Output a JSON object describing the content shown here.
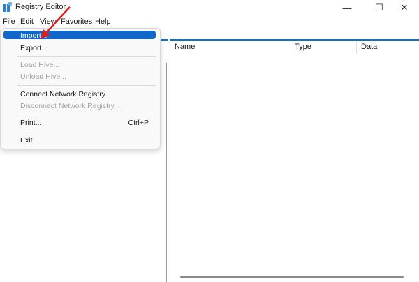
{
  "window": {
    "title": "Registry Editor",
    "controls": {
      "minimize": "—",
      "maximize": "☐",
      "close": "✕"
    }
  },
  "menubar": [
    "File",
    "Edit",
    "View",
    "Favorites",
    "Help"
  ],
  "file_menu": {
    "items": [
      {
        "label": "Import...",
        "enabled": true,
        "highlighted": true
      },
      {
        "label": "Export...",
        "enabled": true
      },
      {
        "label": "Load Hive...",
        "enabled": false
      },
      {
        "label": "Unload Hive...",
        "enabled": false
      },
      {
        "label": "Connect Network Registry...",
        "enabled": true
      },
      {
        "label": "Disconnect Network Registry...",
        "enabled": false
      },
      {
        "label": "Print...",
        "enabled": true,
        "shortcut": "Ctrl+P"
      },
      {
        "label": "Exit",
        "enabled": true
      }
    ]
  },
  "list_columns": [
    "Name",
    "Type",
    "Data"
  ],
  "colors": {
    "accent": "#1067c9",
    "header_line": "#1f6fb7",
    "arrow": "#e0201c"
  }
}
